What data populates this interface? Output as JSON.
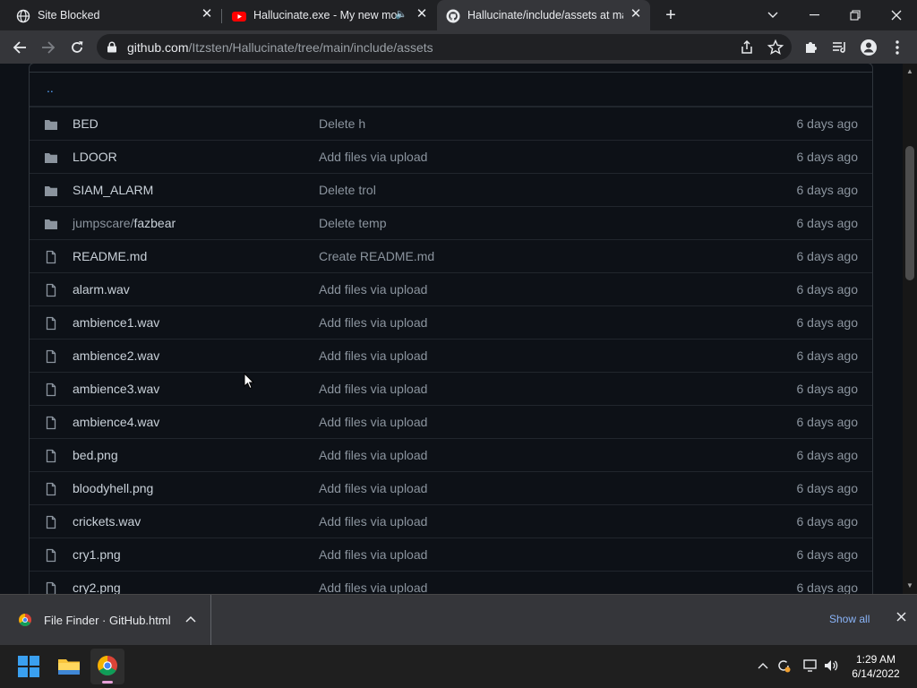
{
  "browser": {
    "tabs": [
      {
        "title": "Site Blocked",
        "icon": "globe-icon",
        "active": false
      },
      {
        "title": "Hallucinate.exe - My new mo",
        "icon": "youtube-icon",
        "audio": true,
        "active": false
      },
      {
        "title": "Hallucinate/include/assets at ma",
        "icon": "github-icon",
        "active": true
      }
    ],
    "url_host": "github.com",
    "url_path": "/Itzsten/Hallucinate/tree/main/include/assets"
  },
  "repo": {
    "parent_link": "..",
    "files": [
      {
        "type": "folder",
        "name": "BED",
        "message": "Delete h",
        "age": "6 days ago"
      },
      {
        "type": "folder",
        "name": "LDOOR",
        "message": "Add files via upload",
        "age": "6 days ago"
      },
      {
        "type": "folder",
        "name": "SIAM_ALARM",
        "message": "Delete trol",
        "age": "6 days ago"
      },
      {
        "type": "folder",
        "name_prefix": "jumpscare/",
        "name": "fazbear",
        "message": "Delete temp",
        "age": "6 days ago"
      },
      {
        "type": "file",
        "name": "README.md",
        "message": "Create README.md",
        "age": "6 days ago"
      },
      {
        "type": "file",
        "name": "alarm.wav",
        "message": "Add files via upload",
        "age": "6 days ago"
      },
      {
        "type": "file",
        "name": "ambience1.wav",
        "message": "Add files via upload",
        "age": "6 days ago"
      },
      {
        "type": "file",
        "name": "ambience2.wav",
        "message": "Add files via upload",
        "age": "6 days ago"
      },
      {
        "type": "file",
        "name": "ambience3.wav",
        "message": "Add files via upload",
        "age": "6 days ago"
      },
      {
        "type": "file",
        "name": "ambience4.wav",
        "message": "Add files via upload",
        "age": "6 days ago"
      },
      {
        "type": "file",
        "name": "bed.png",
        "message": "Add files via upload",
        "age": "6 days ago"
      },
      {
        "type": "file",
        "name": "bloodyhell.png",
        "message": "Add files via upload",
        "age": "6 days ago"
      },
      {
        "type": "file",
        "name": "crickets.wav",
        "message": "Add files via upload",
        "age": "6 days ago"
      },
      {
        "type": "file",
        "name": "cry1.png",
        "message": "Add files via upload",
        "age": "6 days ago"
      },
      {
        "type": "file",
        "name": "cry2.png",
        "message": "Add files via upload",
        "age": "6 days ago"
      }
    ]
  },
  "download": {
    "filename": "File Finder · GitHub.html",
    "show_all": "Show all"
  },
  "taskbar": {
    "time": "1:29 AM",
    "date": "6/14/2022"
  },
  "colors": {
    "page_bg": "#0d1117",
    "link": "#58a6ff",
    "text": "#c9d1d9",
    "muted": "#8b949e",
    "border": "#30363d"
  }
}
